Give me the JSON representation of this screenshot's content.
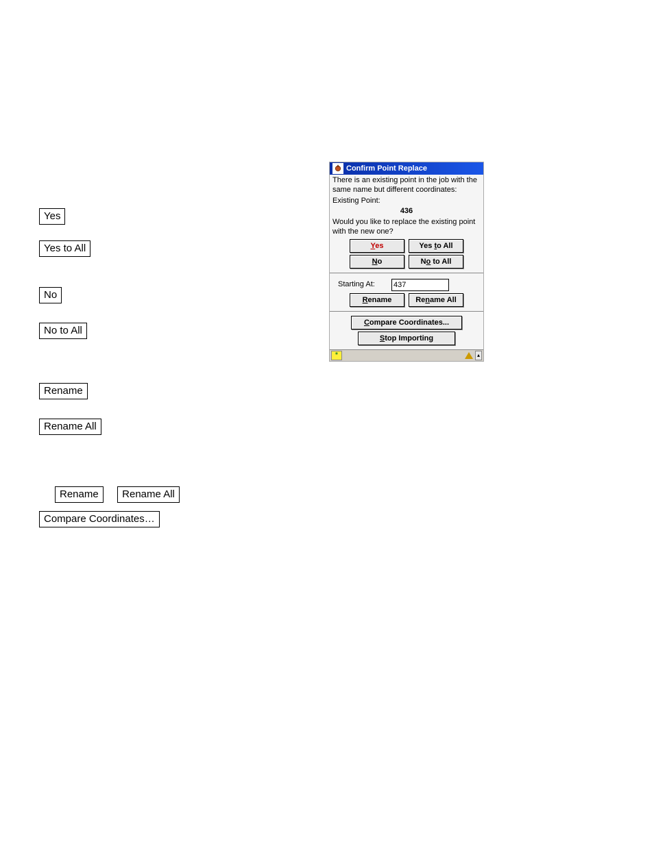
{
  "left": {
    "yes": "Yes",
    "yes_to_all": "Yes to All",
    "no": "No",
    "no_to_all": "No to All",
    "rename": "Rename",
    "rename_all": "Rename All",
    "rename2": "Rename",
    "rename_all2": "Rename All",
    "compare": "Compare Coordinates…"
  },
  "dialog": {
    "title": "Confirm Point Replace",
    "line1": "There is an existing point in the job with the same name but different coordinates:",
    "existing_label": "Existing Point:",
    "existing_value": "436",
    "question": "Would you like to replace the existing point with the new one?",
    "yes": "Yes",
    "yes_to_all": "Yes to All",
    "no": "No",
    "no_to_all": "No to All",
    "starting_at_label": "Starting At:",
    "starting_at_value": "437",
    "rename": "Rename",
    "rename_all": "Rename All",
    "compare": "Compare Coordinates...",
    "stop": "Stop Importing",
    "status_star": "*",
    "status_up": "▴"
  }
}
